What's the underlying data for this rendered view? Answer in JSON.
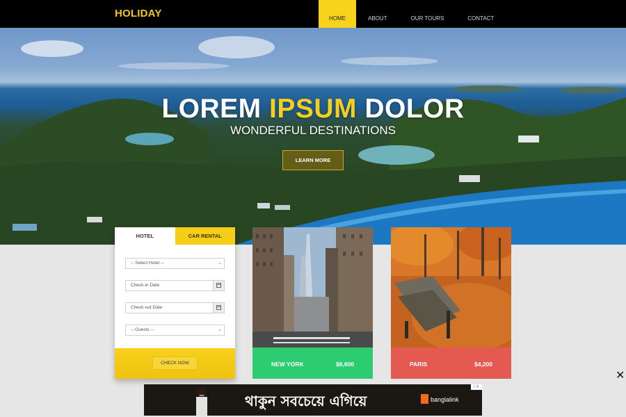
{
  "nav": {
    "logo": "HOLIDAY",
    "items": [
      {
        "label": "HOME",
        "active": true
      },
      {
        "label": "ABOUT",
        "active": false
      },
      {
        "label": "OUR TOURS",
        "active": false
      },
      {
        "label": "CONTACT",
        "active": false
      }
    ]
  },
  "hero": {
    "title_part1": "LOREM ",
    "title_highlight": "IPSUM",
    "title_part2": " DOLOR",
    "subtitle": "WONDERFUL DESTINATIONS",
    "button": "LEARN MORE"
  },
  "booking": {
    "tabs": [
      {
        "label": "HOTEL",
        "active": true
      },
      {
        "label": "CAR RENTAL",
        "active": false
      }
    ],
    "hotel_select": "-- Select Hotel --",
    "checkin_placeholder": "Check-in Date",
    "checkout_placeholder": "Check-out Date",
    "guests_select": "-- Guests --",
    "submit": "CHECK NOW"
  },
  "destinations": [
    {
      "city": "NEW YORK",
      "price": "$6,600",
      "color": "#2ecc71"
    },
    {
      "city": "PARIS",
      "price": "$4,200",
      "color": "#e55a50"
    }
  ],
  "ad": {
    "headline": "থাকুন সবচেয়ে এগিয়ে",
    "brand": "banglalink",
    "corner": "i ✕"
  },
  "close": "✕",
  "colors": {
    "accent": "#f5cf1d",
    "nav_bg": "#000000",
    "page_bg": "#e6e6e6"
  }
}
